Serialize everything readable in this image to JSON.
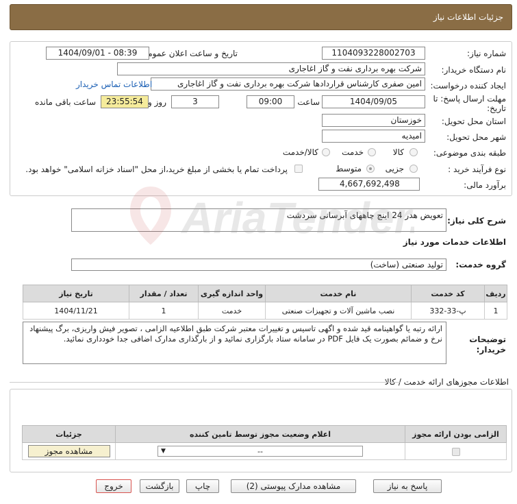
{
  "header": {
    "title": "جزئیات اطلاعات نیاز"
  },
  "form": {
    "need_number_label": "شماره نیاز:",
    "need_number": "1104093228002703",
    "announce_label": "تاریخ و ساعت اعلان عمومی:",
    "announce_value": "1404/09/01 - 08:39",
    "buyer_org_label": "نام دستگاه خریدار:",
    "buyer_org": "شرکت بهره برداری نفت و گاز اغاجاری",
    "creator_label": "ایجاد کننده درخواست:",
    "creator": "امین صفری کارشناس قراردادها شرکت بهره برداری نفت و گاز اغاجاری",
    "contact_link": "اطلاعات تماس خریدار",
    "deadline_label_1": "مهلت ارسال پاسخ: تا",
    "deadline_label_2": "تاریخ:",
    "deadline_date": "1404/09/05",
    "hour_label": "ساعت",
    "deadline_time": "09:00",
    "days_value": "3",
    "days_label": "روز و",
    "remaining_time": "23:55:54",
    "remaining_label": "ساعت باقی مانده",
    "province_label": "استان محل تحویل:",
    "province": "خوزستان",
    "city_label": "شهر محل تحویل:",
    "city": "امیدیه",
    "category_label": "طبقه بندی موضوعی:",
    "category_options": [
      "کالا",
      "خدمت",
      "کالا/خدمت"
    ],
    "process_label": "نوع فرآیند خرید :",
    "process_options": [
      "جزیی",
      "متوسط"
    ],
    "treasury_text": "پرداخت تمام یا بخشی از مبلغ خرید،از محل \"اسناد خزانه اسلامی\" خواهد بود.",
    "budget_label": "برآورد مالی:",
    "budget": "4,667,692,498"
  },
  "description": {
    "label": "شرح کلی نیاز:",
    "value": "تعویض هدر 24 اینچ چاههای آبرسانی سردشت"
  },
  "services": {
    "section_title": "اطلاعات خدمات مورد نیاز",
    "group_label": "گروه خدمت:",
    "group_value": "تولید صنعتی (ساخت)",
    "columns": [
      "ردیف",
      "کد خدمت",
      "نام خدمت",
      "واحد اندازه گیری",
      "تعداد / مقدار",
      "تاریخ نیاز"
    ],
    "rows": [
      [
        "1",
        "پ-33-332",
        "نصب ماشین آلات و تجهیزات صنعتی",
        "خدمت",
        "1",
        "1404/11/21"
      ]
    ]
  },
  "buyer_notes": {
    "label_1": "توضیحات",
    "label_2": "خریدار:",
    "text": "ارائه رتبه یا گواهینامه قید شده و اگهی تاسیس و تغییرات معتبر شرکت طبق اطلاعیه الزامی ، تصویر فیش واریزی، برگ پیشنهاد نرخ و ضمائم بصورت یک فایل PDF در سامانه ستاد بارگزاری نمائید و از بارگذاری مدارک اضافی جدا خودداری نمائید."
  },
  "permits": {
    "title": "اطلاعات مجوزهای ارائه خدمت / کالا",
    "columns": [
      "الزامی بودن ارائه مجوز",
      "اعلام وضعیت مجوز توسط تامین کننده",
      "جزئیات"
    ],
    "select_value": "--",
    "view_button": "مشاهده مجوز"
  },
  "buttons": {
    "reply": "پاسخ به نیاز",
    "attachments": "مشاهده مدارک پیوستی (2)",
    "print": "چاپ",
    "back": "بازگشت",
    "exit": "خروج"
  },
  "watermark": {
    "text": "AriaTender.neT"
  },
  "colors": {
    "header_bg": "#8a6d45",
    "remaining_bg": "#f5eb9b",
    "exit_border": "#d9534f",
    "link": "#1a5fb4"
  }
}
